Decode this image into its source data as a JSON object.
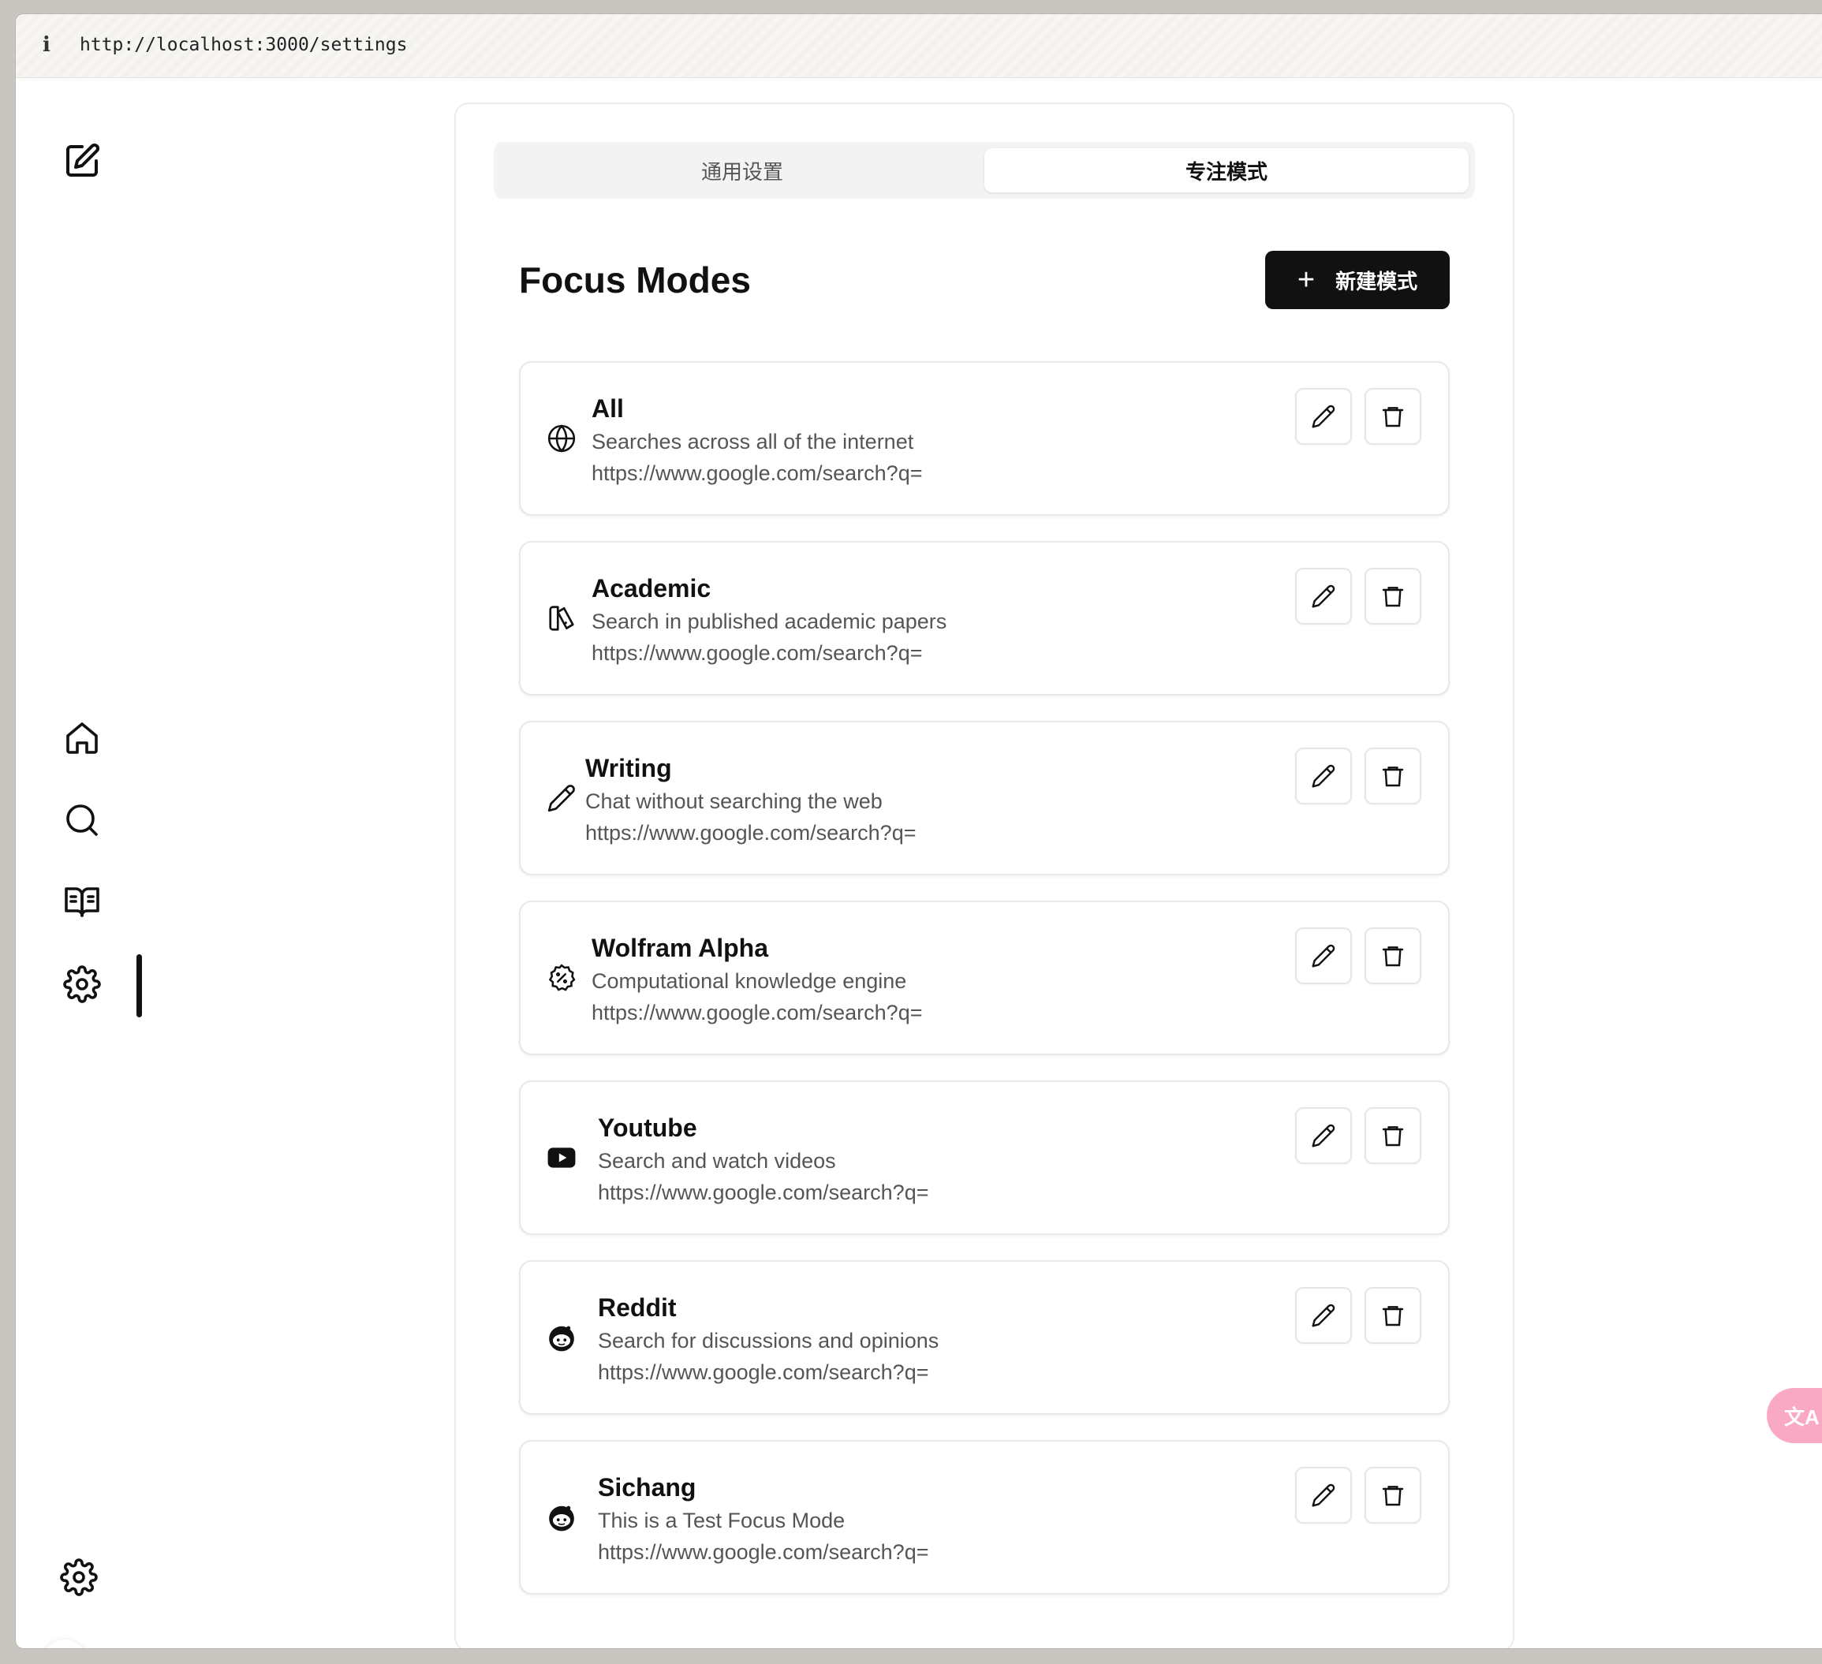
{
  "browser": {
    "url": "http://localhost:3000/settings"
  },
  "tabs": [
    {
      "label": "通用设置",
      "active": false
    },
    {
      "label": "专注模式",
      "active": true
    }
  ],
  "section": {
    "title": "Focus Modes",
    "new_button_label": "新建模式"
  },
  "modes": [
    {
      "name": "All",
      "description": "Searches across all of the internet",
      "url": "https://www.google.com/search?q=",
      "icon": "globe-icon"
    },
    {
      "name": "Academic",
      "description": "Search in published academic papers",
      "url": "https://www.google.com/search?q=",
      "icon": "academic-icon"
    },
    {
      "name": "Writing",
      "description": "Chat without searching the web",
      "url": "https://www.google.com/search?q=",
      "icon": "pencil-icon"
    },
    {
      "name": "Wolfram Alpha",
      "description": "Computational knowledge engine",
      "url": "https://www.google.com/search?q=",
      "icon": "percent-badge-icon"
    },
    {
      "name": "Youtube",
      "description": "Search and watch videos",
      "url": "https://www.google.com/search?q=",
      "icon": "youtube-icon"
    },
    {
      "name": "Reddit",
      "description": "Search for discussions and opinions",
      "url": "https://www.google.com/search?q=",
      "icon": "reddit-icon"
    },
    {
      "name": "Sichang",
      "description": "This is a Test Focus Mode",
      "url": "https://www.google.com/search?q=",
      "icon": "reddit-icon"
    }
  ],
  "sidebar": {
    "items": [
      {
        "icon": "new-chat-icon"
      },
      {
        "icon": "home-icon"
      },
      {
        "icon": "search-icon"
      },
      {
        "icon": "library-icon"
      },
      {
        "icon": "settings-icon",
        "active": true
      }
    ]
  },
  "translate_widget": {
    "label": "文A"
  },
  "colors": {
    "accent": "#111111",
    "widget": "#f9a9c4"
  }
}
